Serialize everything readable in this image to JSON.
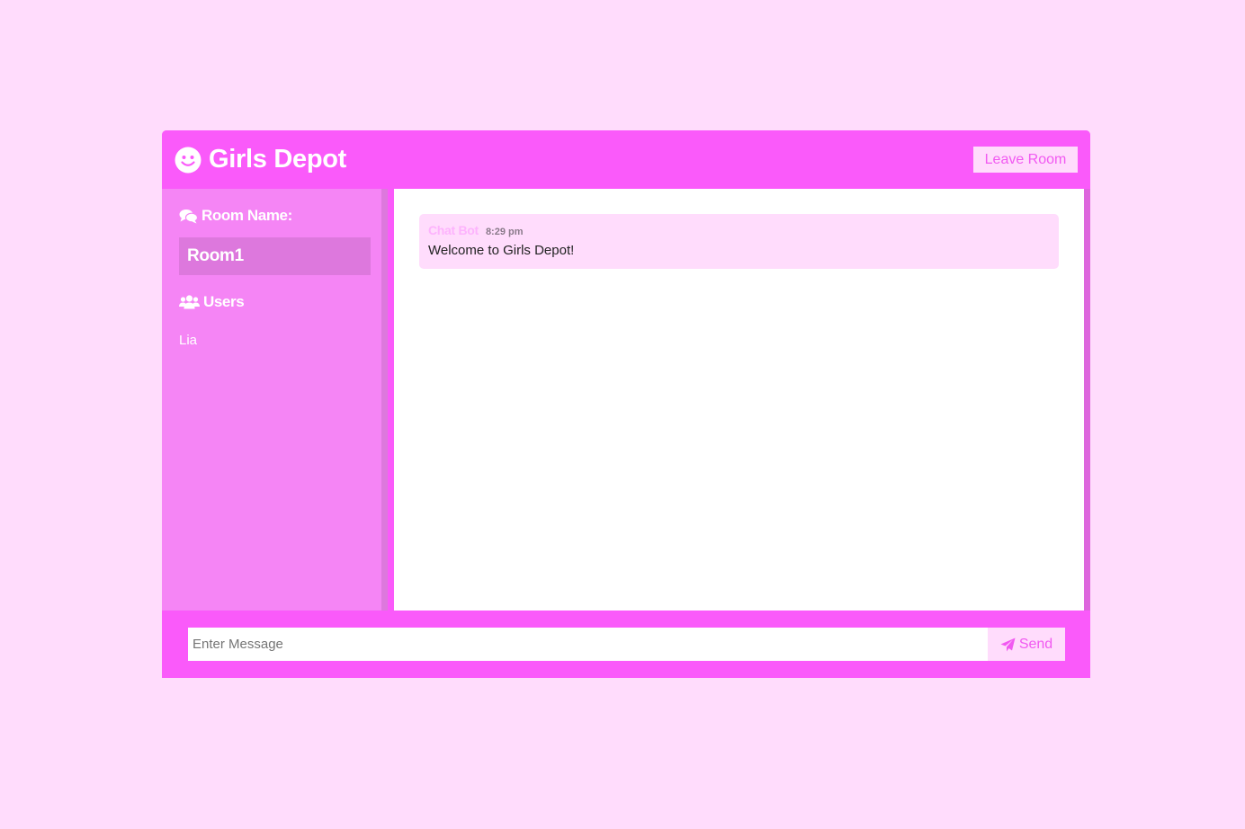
{
  "header": {
    "brand_icon": "smile-icon",
    "title": "Girls Depot",
    "leave_label": "Leave Room"
  },
  "sidebar": {
    "room_heading": "Room Name:",
    "room_icon": "comments-icon",
    "room_name": "Room1",
    "users_heading": "Users",
    "users_icon": "users-icon",
    "users": [
      "Lia"
    ]
  },
  "messages": [
    {
      "author": "Chat Bot",
      "time": "8:29 pm",
      "text": "Welcome to Girls Depot!"
    }
  ],
  "form": {
    "placeholder": "Enter Message",
    "send_label": "Send",
    "send_icon": "paper-plane-icon"
  },
  "colors": {
    "background": "#ffdcfc",
    "header": "#fa5afa",
    "sidebar": "#f585f5",
    "room_box": "#dd78dd",
    "accent_text": "#f159f1"
  }
}
